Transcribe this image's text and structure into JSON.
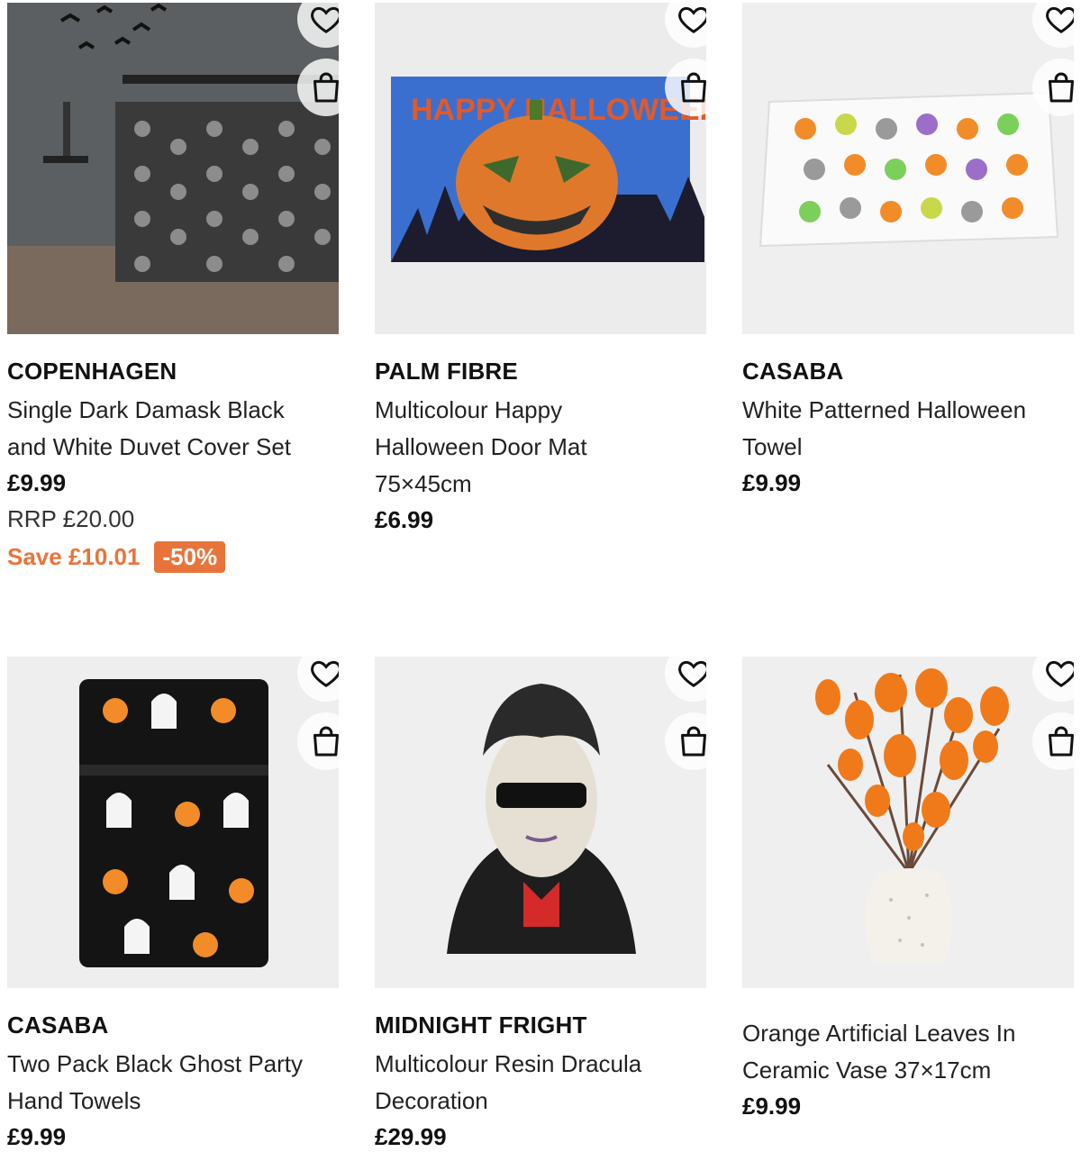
{
  "products": [
    {
      "brand": "COPENHAGEN",
      "title_lines": [
        "Single Dark Damask Black",
        "and White Duvet Cover Set"
      ],
      "price": "£9.99",
      "rrp": "RRP £20.00",
      "save": "Save £10.01",
      "discount": "-50%",
      "image": "damask-duvet-bedroom"
    },
    {
      "brand": "PALM FIBRE",
      "title_lines": [
        "Multicolour Happy",
        "Halloween Door Mat",
        "75×45cm"
      ],
      "price": "£6.99",
      "image": "halloween-pumpkin-doormat",
      "image_text": "HAPPY HALLOWEEN"
    },
    {
      "brand": "CASABA",
      "title_lines": [
        "White Patterned Halloween",
        "Towel"
      ],
      "price": "£9.99",
      "image": "halloween-pattern-towel"
    },
    {
      "brand": "CASABA",
      "title_lines": [
        "Two Pack Black Ghost Party",
        "Hand Towels"
      ],
      "price": "£9.99",
      "image": "ghost-hand-towels"
    },
    {
      "brand": "MIDNIGHT FRIGHT",
      "title_lines": [
        "Multicolour Resin Dracula",
        "Decoration"
      ],
      "price": "£29.99",
      "image": "dracula-bust"
    },
    {
      "brand": "",
      "title_lines": [
        "Orange Artificial Leaves In",
        "Ceramic Vase 37×17cm"
      ],
      "price": "£9.99",
      "image": "orange-leaves-vase"
    }
  ],
  "icons": {
    "wishlist": "heart-outline-icon",
    "add_to_bag": "shopping-bag-icon"
  },
  "colors": {
    "accent": "#e8743b",
    "text": "#111111",
    "placeholder": "#eeeeee"
  }
}
